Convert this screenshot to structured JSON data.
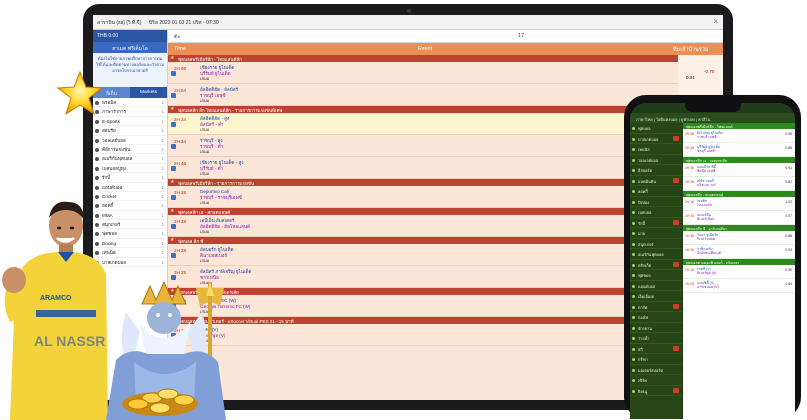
{
  "laptop": {
    "titlebar": {
      "left": "ลาราบิน (sa) [วิ.ที.จี]",
      "middle": "บิริล 2023 01 03 21 ปริศ - 07:30",
      "close": "×"
    },
    "account": "THB 0.00",
    "sidebar": {
      "header": "ยาเมด ฟรีเด็มโอ",
      "note": "ต้องไม่ใช่กายภาพปรึกษาการการต่อ ใช้ได้และติดตามทางคอร์ดและกำตามอารยโบราณาษาตรี",
      "tabs": [
        "ก็เก็บ",
        "Markets"
      ],
      "sports": [
        {
          "label": "พรอมิส",
          "count": "1"
        },
        {
          "label": "ภาษาราการ",
          "count": "1"
        },
        {
          "label": "E-Sports",
          "count": "1"
        },
        {
          "label": "สอบรัย",
          "count": "1"
        },
        {
          "label": "วอลเลย์บอล",
          "count": "1"
        },
        {
          "label": "คีย์การแข่งขัน",
          "count": "1"
        },
        {
          "label": "อเมริกันฟุตบอล",
          "count": "1"
        },
        {
          "label": "เบสบอลปู่ทุ่ง",
          "count": "1"
        },
        {
          "label": "รักบี้",
          "count": "1"
        },
        {
          "label": "แฮนด์บอล",
          "count": "1"
        },
        {
          "label": "Cricket",
          "count": "1"
        },
        {
          "label": "ฮอคกี้",
          "count": "1"
        },
        {
          "label": "MMA",
          "count": "1"
        },
        {
          "label": "สนุกเกอร์",
          "count": "1"
        },
        {
          "label": "ฟุตซอล",
          "count": "1"
        },
        {
          "label": "Boxing",
          "count": "1"
        },
        {
          "label": "เทนนิส",
          "count": "1"
        },
        {
          "label": "บาสเกตบอล",
          "count": "1"
        }
      ]
    },
    "toolbar": {
      "left": "ตะ",
      "center": "17"
    },
    "columns": {
      "time": "Time",
      "event": "Event",
      "odds": "ทีมเจ้าบ้านรวม"
    },
    "leagues": [
      {
        "name": "ฟุตบอลพรีเมียร์ลีก - ไทยแลนด์ลีก",
        "matches": [
          {
            "time": "2H 66",
            "home": "เชียงราย ยูไนเต็ด",
            "away": "บุรีรัมย์ ยูไนเต็ด",
            "draw": "เสมอ",
            "alt": false
          },
          {
            "time": "2H 54",
            "home": "อัลอิตติฮัด - อัลนัสร์",
            "away": "ราชบุรี เอฟซี",
            "draw": "เสมอ",
            "alt": false
          }
        ]
      },
      {
        "name": "ฟุตบอลลีก ลีก ไทยแลนด์ลีก - รายการการแข่งขันพิเศษ",
        "matches": [
          {
            "time": "2H 34",
            "home": "อัลอิตติฮัด - สูง",
            "away": "อัลนัสร์ - ต่ำ",
            "draw": "เสมอ",
            "alt": true
          },
          {
            "time": "2H 34",
            "home": "ราชบุรี - สูง",
            "away": "ราชบุรี - ต่ำ",
            "draw": "เสมอ",
            "alt": false
          },
          {
            "time": "2H 48",
            "home": "เชียงราย ยูไนเต็ด - สูง",
            "away": "บุรีรัมย์ - ต่ำ",
            "draw": "เสมอ",
            "alt": false
          }
        ]
      },
      {
        "name": "ฟุตบอลพรีเมียร์ลีก - รายการการแข่งขัน",
        "matches": [
          {
            "time": "2H 38",
            "home": "Deportivo Cali",
            "away": "ราชบุรี - ราชบุรีเอฟซี",
            "draw": "เสมอ",
            "alt": false
          }
        ]
      },
      {
        "name": "ฟุตบอลลีก เอ - สกอตแลนด์",
        "matches": [
          {
            "time": "2H 38",
            "home": "เอบีเอ็น อัมสเตอร์",
            "away": "อัลอิตติฮัด - ฮัลโหลแลนด์",
            "draw": "เสมอ",
            "alt": false
          }
        ]
      },
      {
        "name": "ฟุตบอล ลีก ซี",
        "matches": [
          {
            "time": "2H 38",
            "home": "อัลบอร์ก ยูไนเต็ด",
            "away": "ดินามอสเบอร์",
            "draw": "เสมอ",
            "alt": false
          },
          {
            "time": "2H 28",
            "home": "อัลนัสร์ ภาษีเจริญ ยูไนเต็ด",
            "away": "ชาวเหนือ",
            "draw": "เสมอ",
            "alt": false
          }
        ]
      },
      {
        "name": "ฟุตบอลพรีเมียร์ลีก - ออสเตรเลีย",
        "matches": [
          {
            "time": "2H 38",
            "home": "Deportivo SC (W)",
            "away": "Georgia Torrento FC (W)",
            "draw": "เสมอ",
            "alt": false
          }
        ]
      },
      {
        "name": "ฟุตบอลทางคอมพิวเตอร์ - eSoccer Virtual PES 21 - 15 นาที",
        "matches": [
          {
            "time": "2H 18",
            "home": "เชลซี (V)",
            "away": "ลิเวอร์พูล (V)",
            "draw": "เสมอ",
            "alt": false
          }
        ]
      }
    ],
    "odds": [
      "-0.75",
      "0.91",
      "0.67",
      "1",
      "0.56",
      "0.97"
    ]
  },
  "phone": {
    "bar": "ภาษาไทย | ไอดีแทงบอล | ยูฟ่าเบท | คาสิโน",
    "sidebar": [
      "ฟุตบอล",
      "บาสเกตบอล",
      "เทนนิส",
      "วอลเลย์บอล",
      "อีสปอร์ต",
      "แบดมินตัน",
      "ฮอคกี้",
      "ปิงปอง",
      "เบสบอล",
      "รักบี้",
      "มวย",
      "สนุกเกอร์",
      "อเมริกันฟุตบอล",
      "คริกเก็ต",
      "ฟุตซอล",
      "แฮนด์บอล",
      "เอ็มเอ็มเอ",
      "ดาร์ท",
      "กอล์ฟ",
      "จักรยาน",
      "ว่ายน้ำ",
      "สกี",
      "กรีฑา",
      "มอเตอร์สปอร์ต",
      "เซิร์ฟ",
      "ยิงธนู"
    ],
    "leagues": [
      {
        "name": "ฟุตบอลพรีเมียร์ลีก - ไทยแลนด์",
        "matches": [
          {
            "time": "2H 56",
            "home": "BG ปทุม ยูไนเต็ด",
            "away": "ราชบุรี เอฟซี",
            "odds": "0.95"
          },
          {
            "time": "2H 48",
            "home": "บุรีรัมย์ ยูไนเต็ด",
            "away": "ชลบุรี เอฟซี",
            "odds": "0.88"
          }
        ]
      },
      {
        "name": "ฟุตบอลลีก เอ - ออสเตรเลีย",
        "matches": [
          {
            "time": "2H 38",
            "home": "เมลเบิร์น ซิตี้",
            "away": "ซิดนีย์ เอฟซี",
            "odds": "0.91"
          },
          {
            "time": "2H 28",
            "home": "เพิร์ธ กลอรี่",
            "away": "บริสเบน รอร์",
            "odds": "0.82"
          }
        ]
      },
      {
        "name": "ฟุตบอลลีก - สกอตแลนด์",
        "matches": [
          {
            "time": "2H 18",
            "home": "เซลติก",
            "away": "เรนเจอร์ส",
            "odds": "1.02"
          },
          {
            "time": "1H 44",
            "home": "อเบอร์ดีน",
            "away": "ฮิเบอร์เนี่ยน",
            "odds": "0.97"
          }
        ]
      },
      {
        "name": "ฟุตบอลลีก ซี - อาร์เจนตินา",
        "matches": [
          {
            "time": "1H 38",
            "home": "โบคา จูเนียร์ส",
            "away": "ริเวอร์ เพลต",
            "odds": "0.86"
          },
          {
            "time": "1H 28",
            "home": "ราซิ่ง คลับ",
            "away": "อินดิเพนเดียนเต้",
            "odds": "0.93"
          }
        ]
      },
      {
        "name": "ฟุตบอลทางคอมพิวเตอร์ - eSoccer",
        "matches": [
          {
            "time": "1H 18",
            "home": "เชลซี (V)",
            "away": "ลิเวอร์พูล (V)",
            "odds": "0.90"
          },
          {
            "time": "1H 08",
            "home": "แมนซิตี้ (V)",
            "away": "อาร์เซนอล (V)",
            "odds": "0.84"
          }
        ]
      }
    ]
  },
  "decor": {
    "player_shirt": "AL NASSR",
    "player_sponsor": "ARAMCO"
  }
}
